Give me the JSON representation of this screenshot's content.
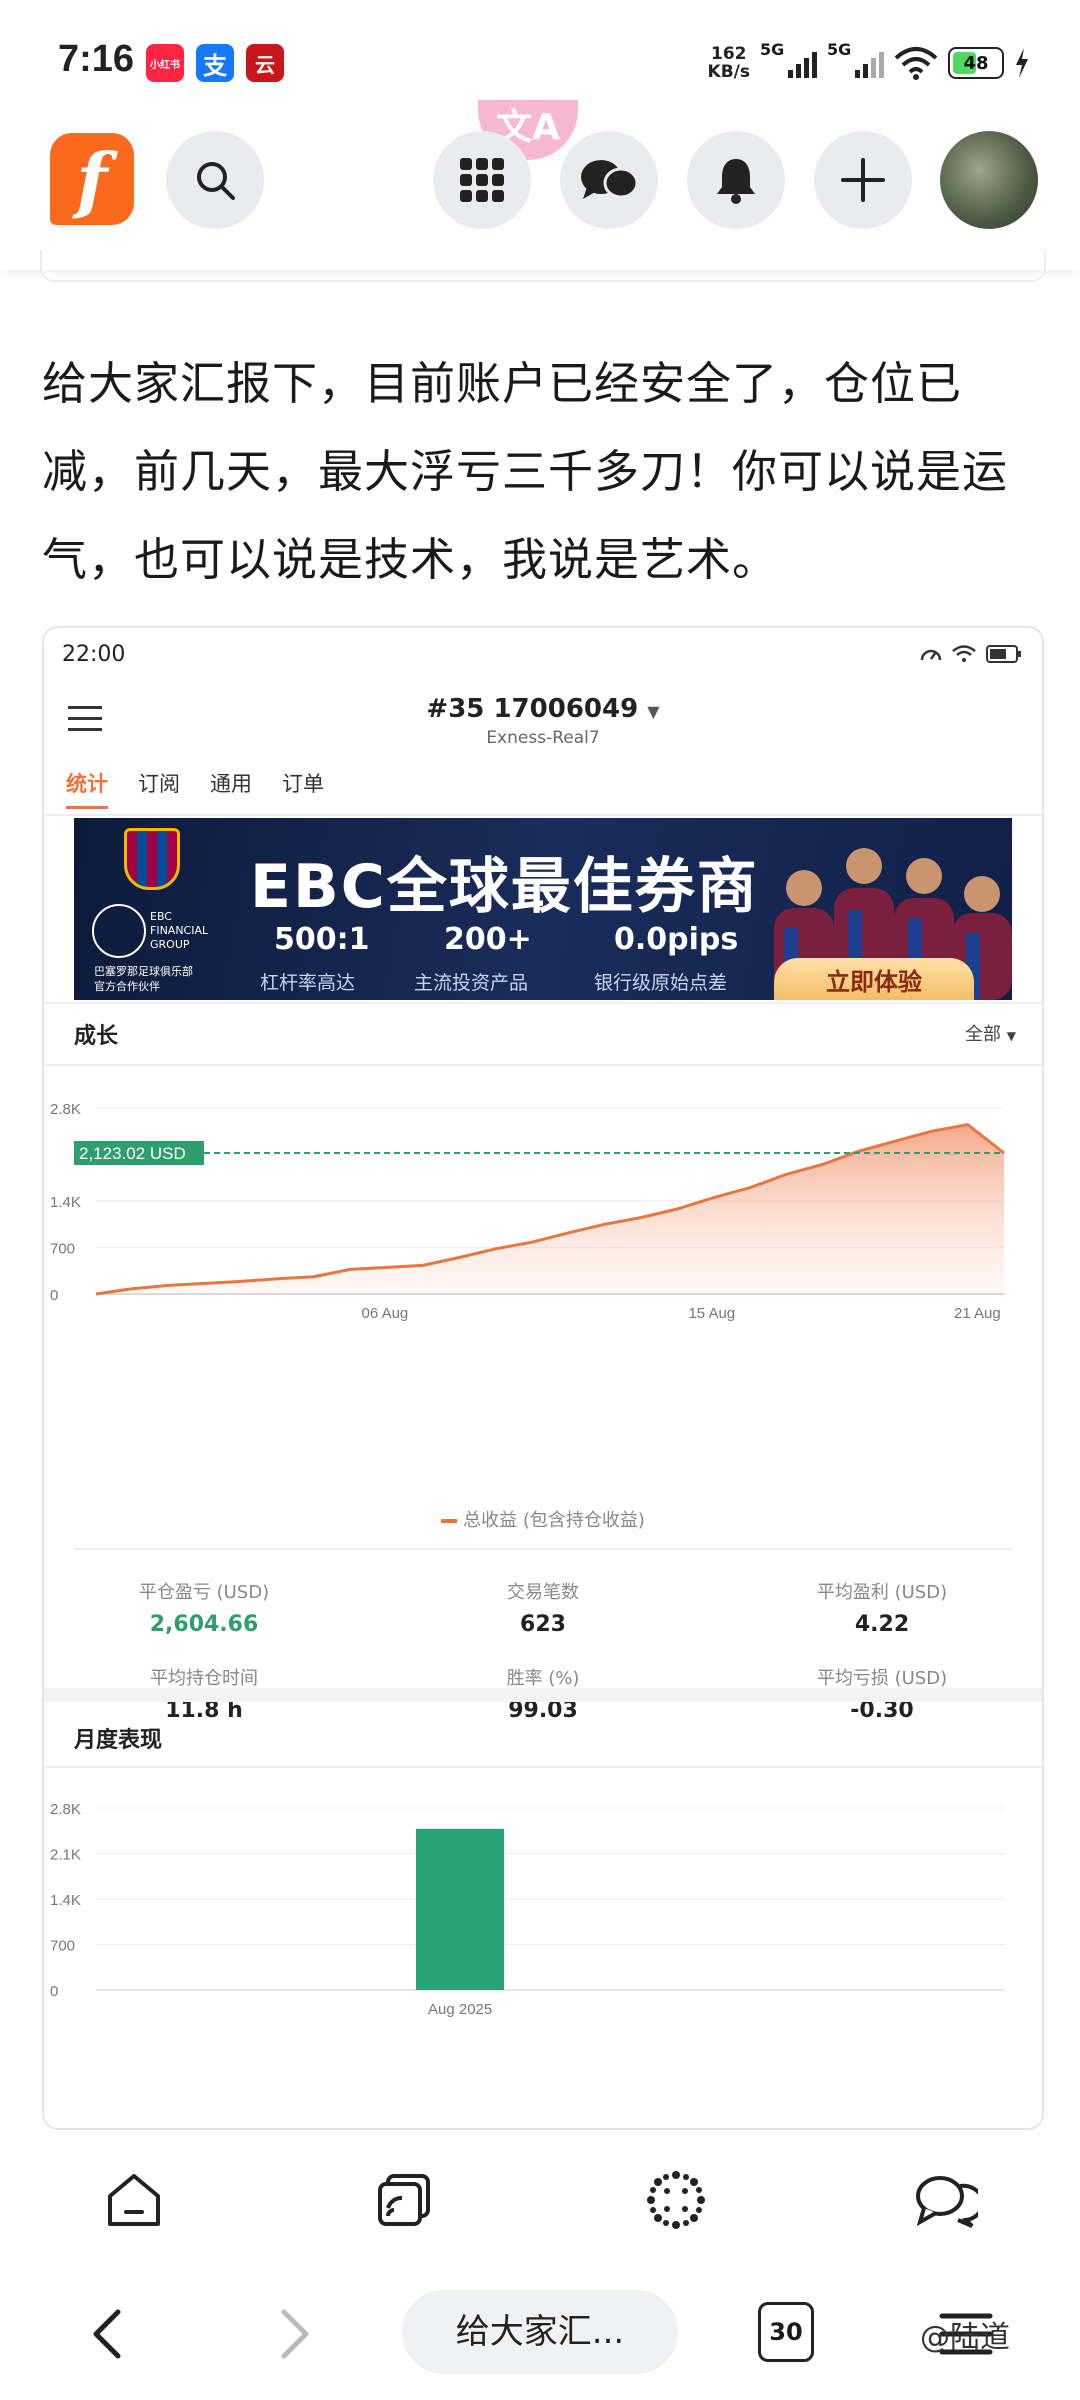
{
  "status_bar": {
    "time": "7:16",
    "apps": [
      "小红书",
      "支",
      "云"
    ],
    "net_speed_value": "162",
    "net_speed_unit": "KB/s",
    "signal1_label": "5G",
    "signal2_label": "5G",
    "battery": "48"
  },
  "header": {
    "logo_letter": "f",
    "translate_badge": "文A"
  },
  "post": {
    "text": "给大家汇报下，目前账户已经安全了，仓位已减，前几天，最大浮亏三千多刀！你可以说是运气，也可以说是技术，我说是艺术。"
  },
  "screenshot": {
    "time": "22:00",
    "account_number": "#35",
    "account_id": "17006049",
    "server": "Exness-Real7",
    "tabs": [
      "统计",
      "订阅",
      "通用",
      "订单"
    ],
    "active_tab": 0,
    "banner": {
      "title": "EBC全球最佳券商",
      "stats": [
        "500:1",
        "200+",
        "0.0pips"
      ],
      "subs": [
        "杠杆率高达",
        "主流投资产品",
        "银行级原始点差"
      ],
      "cta": "立即体验",
      "brand_line1": "EBC",
      "brand_line2": "FINANCIAL",
      "brand_line3": "GROUP",
      "partner_line1": "巴塞罗那足球俱乐部",
      "partner_line2": "官方合作伙伴"
    },
    "growth": {
      "title": "成长",
      "filter": "全部",
      "current_label": "2,123.02 USD",
      "legend": "总收益 (包含持仓收益)"
    },
    "stats": [
      {
        "label": "平仓盈亏 (USD)",
        "value": "2,604.66"
      },
      {
        "label": "交易笔数",
        "value": "623"
      },
      {
        "label": "平均盈利 (USD)",
        "value": "4.22"
      },
      {
        "label": "平均持仓时间",
        "value": "11.8 h"
      },
      {
        "label": "胜率 (%)",
        "value": "99.03"
      },
      {
        "label": "平均亏损 (USD)",
        "value": "-0.30"
      }
    ],
    "monthly": {
      "title": "月度表现"
    }
  },
  "bottom": {
    "url_title": "给大家汇...",
    "tab_count": "30",
    "watermark": "@陆道"
  },
  "chart_data": [
    {
      "type": "area",
      "title": "成长",
      "x_ticks": [
        "06 Aug",
        "15 Aug",
        "21 Aug"
      ],
      "y_ticks": [
        "2.8K",
        "1.4K",
        "700",
        "0"
      ],
      "ylim": [
        0,
        2800
      ],
      "x": [
        0,
        1,
        2,
        3,
        4,
        5,
        6,
        7,
        8,
        9,
        10,
        11,
        12,
        13,
        14,
        15,
        16,
        17,
        18,
        19,
        20,
        21,
        22,
        23,
        24,
        25
      ],
      "values": [
        0,
        80,
        130,
        160,
        190,
        230,
        260,
        370,
        400,
        430,
        550,
        680,
        780,
        920,
        1050,
        1150,
        1280,
        1450,
        1600,
        1800,
        1950,
        2150,
        2300,
        2450,
        2550,
        2123
      ],
      "reference_line": 2123.02,
      "legend": "总收益 (包含持仓收益)",
      "colors": {
        "line": "#e8763f",
        "fill": "#f6b59a",
        "ref": "#2f9e6e"
      }
    },
    {
      "type": "bar",
      "title": "月度表现",
      "categories": [
        "Aug 2025"
      ],
      "values": [
        2480
      ],
      "y_ticks": [
        "2.8K",
        "2.1K",
        "1.4K",
        "700",
        "0"
      ],
      "ylim": [
        0,
        2800
      ],
      "colors": {
        "bar": "#2aa277"
      }
    }
  ]
}
